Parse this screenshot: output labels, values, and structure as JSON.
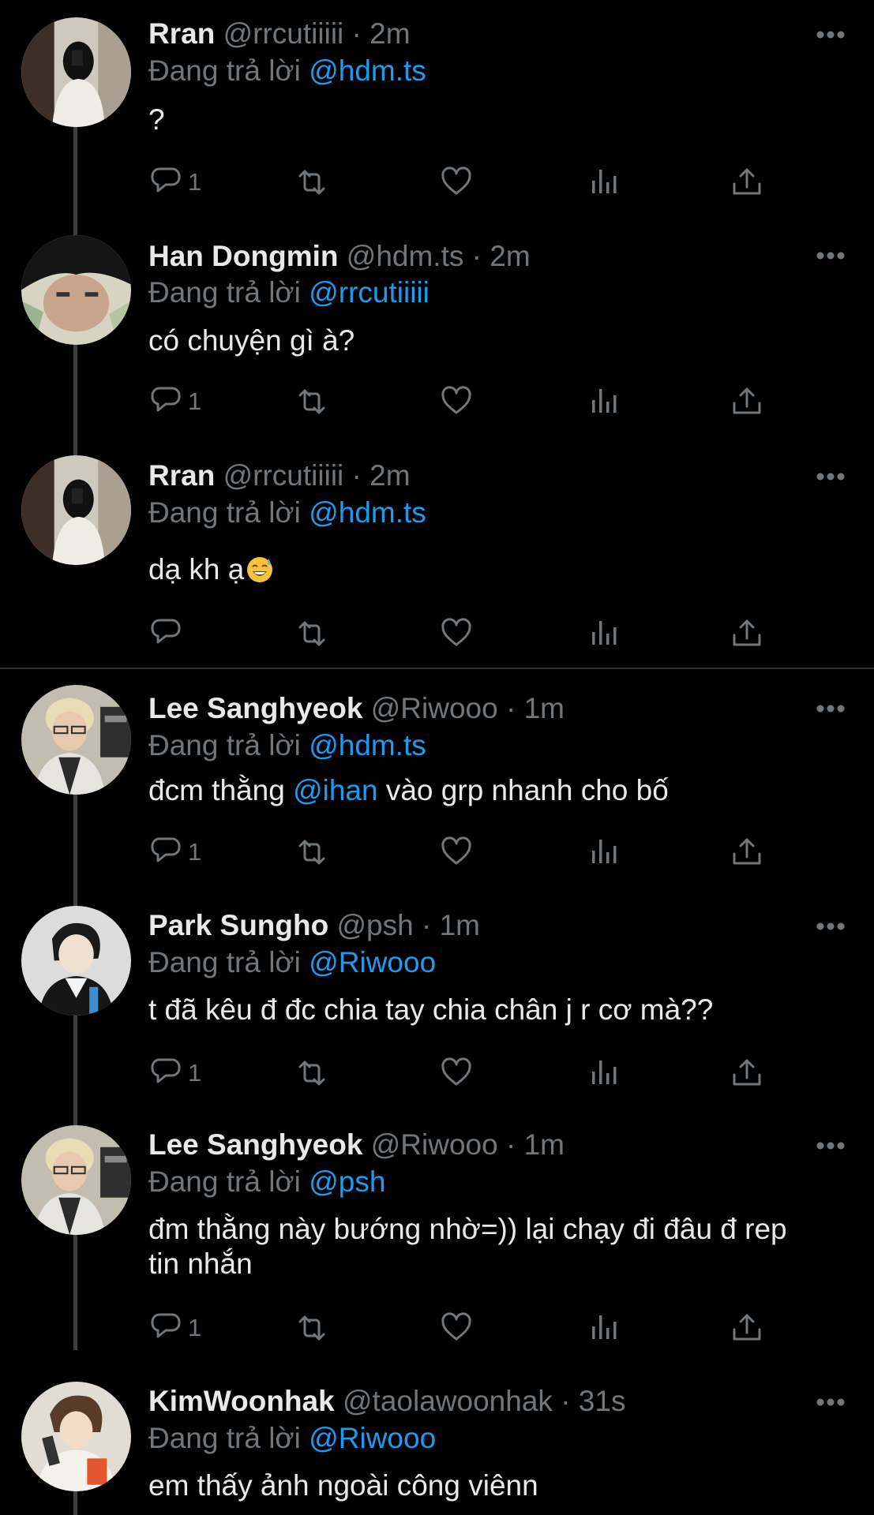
{
  "reply_prefix": "Đang trả lời",
  "colors": {
    "background": "#000000",
    "text": "#e7e9ea",
    "muted": "#71767b",
    "accent": "#1d9bf0"
  },
  "icons": [
    "reply-icon",
    "retweet-icon",
    "like-icon",
    "views-icon",
    "share-icon",
    "more-icon"
  ],
  "tweets": [
    {
      "name": "Rran",
      "handle": "@rrcutiiiii",
      "sep": "·",
      "time": "2m",
      "reply_to": "@hdm.ts",
      "text": "?",
      "reply_count": "1"
    },
    {
      "name": "Han Dongmin",
      "handle": "@hdm.ts",
      "sep": "·",
      "time": "2m",
      "reply_to": "@rrcutiiiii",
      "text": "có chuyện gì à?",
      "reply_count": "1"
    },
    {
      "name": "Rran",
      "handle": "@rrcutiiiii",
      "sep": "·",
      "time": "2m",
      "reply_to": "@hdm.ts",
      "text": "dạ kh ạ",
      "emoji": "sweat-smile-emoji",
      "reply_count": ""
    },
    {
      "name": "Lee Sanghyeok",
      "handle": "@Riwooo",
      "sep": "·",
      "time": "1m",
      "reply_to": "@hdm.ts",
      "text_before": "đcm thằng",
      "text_mention": "@ihan",
      "text_after": "vào grp nhanh cho bố",
      "reply_count": "1"
    },
    {
      "name": "Park Sungho",
      "handle": "@psh",
      "sep": "·",
      "time": "1m",
      "reply_to": "@Riwooo",
      "text": "t đã kêu đ đc chia tay chia chân j r cơ mà??",
      "reply_count": "1"
    },
    {
      "name": "Lee Sanghyeok",
      "handle": "@Riwooo",
      "sep": "·",
      "time": "1m",
      "reply_to": "@psh",
      "text_line1": "đm thằng này bướng nhờ=)) lại chạy đi đâu đ rep",
      "text_line2": "tin nhắn",
      "reply_count": "1"
    },
    {
      "name": "KimWoonhak",
      "handle": "@taolawoonhak",
      "sep": "·",
      "time": "31s",
      "reply_to": "@Riwooo",
      "text": "em thấy ảnh ngoài công viênn"
    }
  ]
}
